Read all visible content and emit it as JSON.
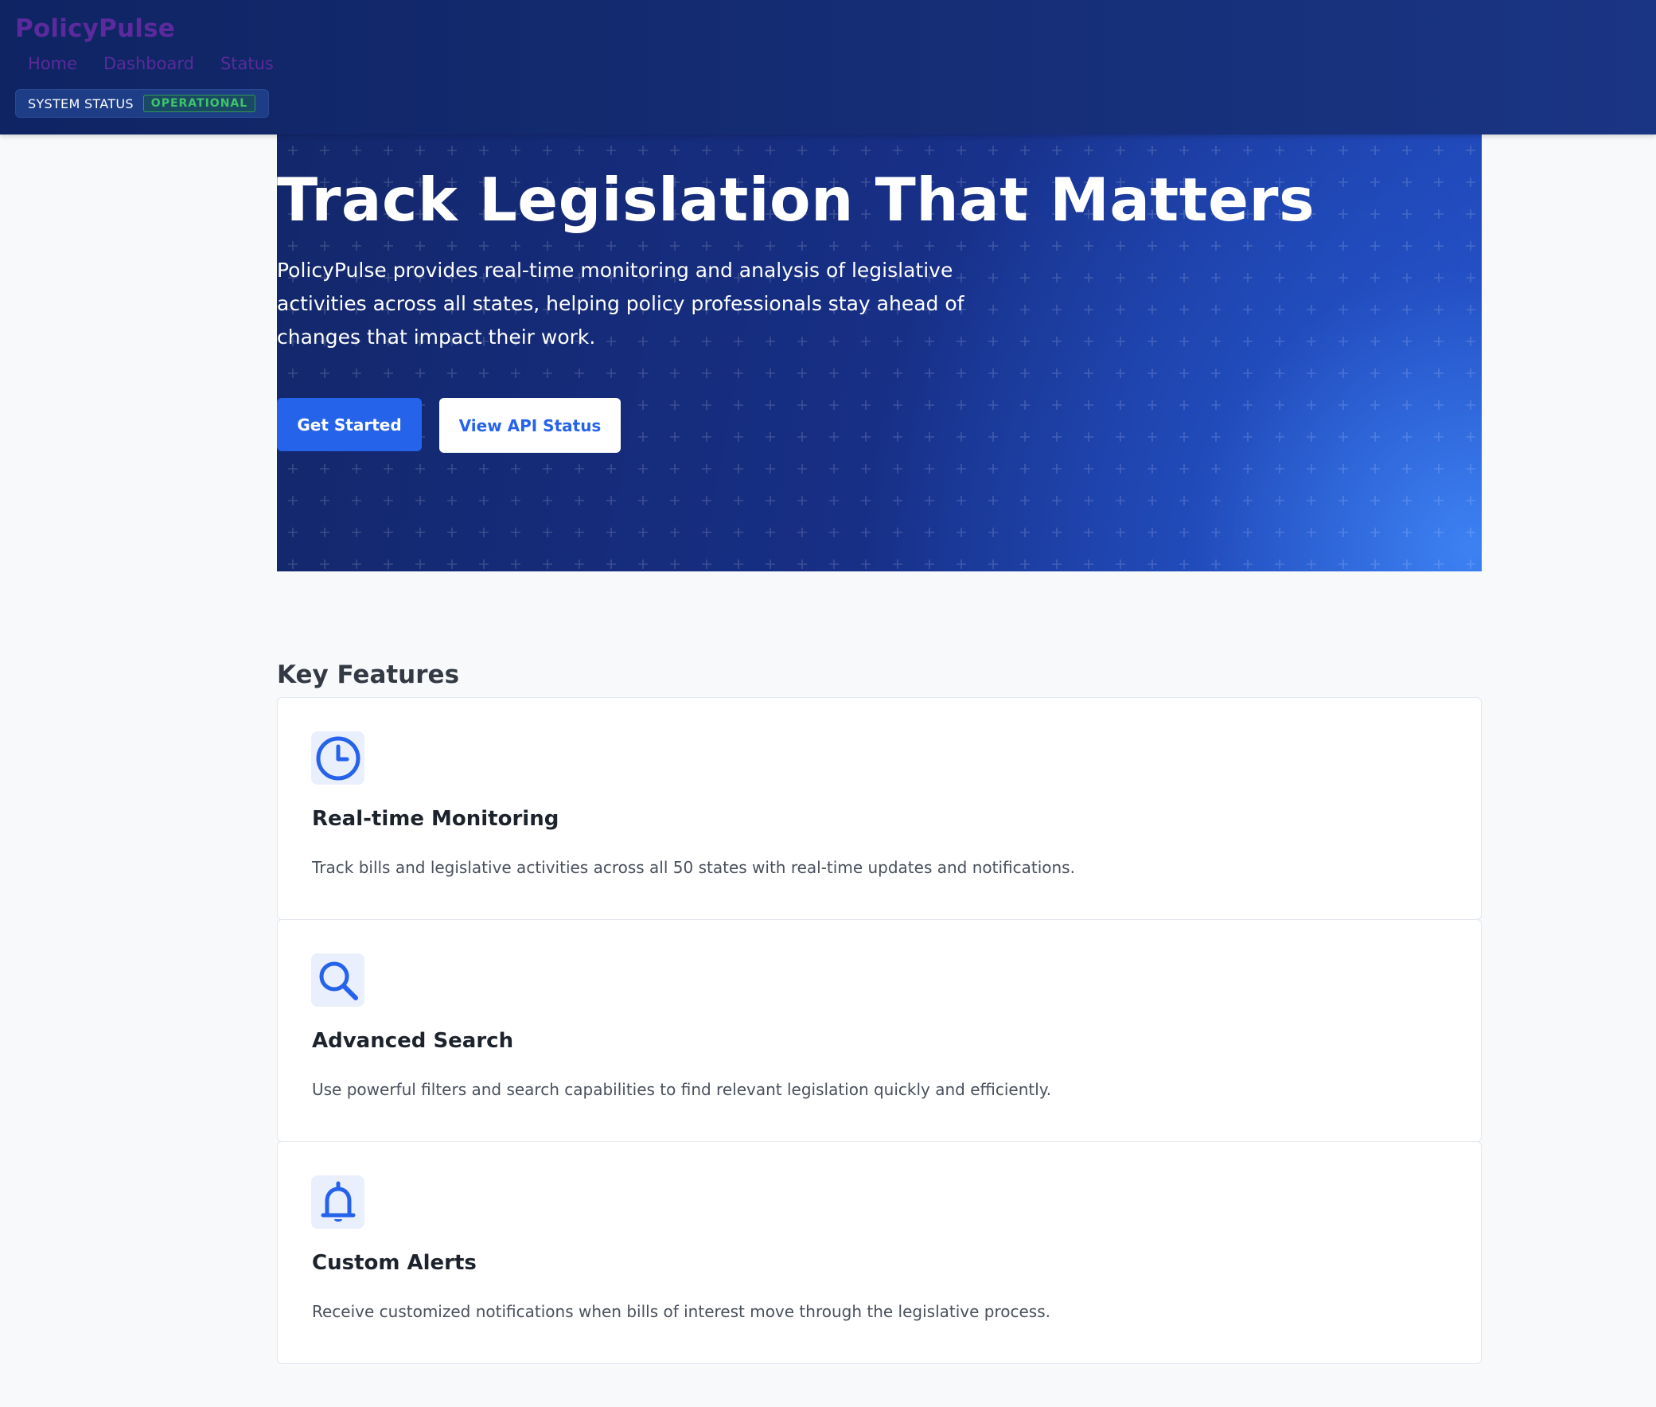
{
  "header": {
    "brand": "PolicyPulse",
    "nav": [
      {
        "label": "Home"
      },
      {
        "label": "Dashboard"
      },
      {
        "label": "Status"
      }
    ],
    "status": {
      "label": "SYSTEM STATUS",
      "value": "OPERATIONAL",
      "color": "#3ec46a"
    }
  },
  "hero": {
    "title": "Track Legislation That Matters",
    "description": "PolicyPulse provides real-time monitoring and analysis of legislative activities across all states, helping policy professionals stay ahead of changes that impact their work.",
    "primary_button": "Get Started",
    "secondary_button": "View API Status"
  },
  "features": {
    "title": "Key Features",
    "items": [
      {
        "icon": "clock-icon",
        "title": "Real-time Monitoring",
        "description": "Track bills and legislative activities across all 50 states with real-time updates and notifications."
      },
      {
        "icon": "search-icon",
        "title": "Advanced Search",
        "description": "Use powerful filters and search capabilities to find relevant legislation quickly and efficiently."
      },
      {
        "icon": "bell-icon",
        "title": "Custom Alerts",
        "description": "Receive customized notifications when bills of interest move through the legislative process."
      }
    ]
  },
  "colors": {
    "accent": "#2563eb",
    "header_bg": "#0f2463",
    "brand_text": "#5b2a9c"
  }
}
